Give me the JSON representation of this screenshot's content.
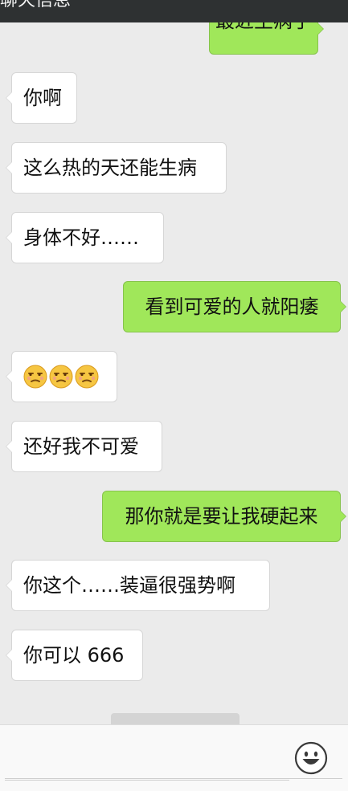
{
  "header": {
    "title": "聊天信息"
  },
  "messages": [
    {
      "side": "right",
      "text": "最近生病了"
    },
    {
      "side": "left",
      "text": "你啊"
    },
    {
      "side": "left",
      "text": "这么热的天还能生病"
    },
    {
      "side": "left",
      "text": "身体不好……"
    },
    {
      "side": "right",
      "text": "看到可爱的人就阳痿"
    },
    {
      "side": "left",
      "emoji": [
        "unamused-face-icon",
        "unamused-face-icon",
        "unamused-face-icon"
      ]
    },
    {
      "side": "left",
      "text": "还好我不可爱"
    },
    {
      "side": "right",
      "text": "那你就是要让我硬起来"
    },
    {
      "side": "left",
      "text": "你这个……装逼很强势啊"
    },
    {
      "side": "left",
      "text": "你可以 666"
    }
  ],
  "composer": {
    "input_value": "",
    "emoji_icon": "smiley-icon"
  },
  "colors": {
    "chat_bg": "#ebebeb",
    "left_bubble": "#ffffff",
    "right_bubble": "#a0e75a",
    "header_bg": "#2e3132"
  }
}
